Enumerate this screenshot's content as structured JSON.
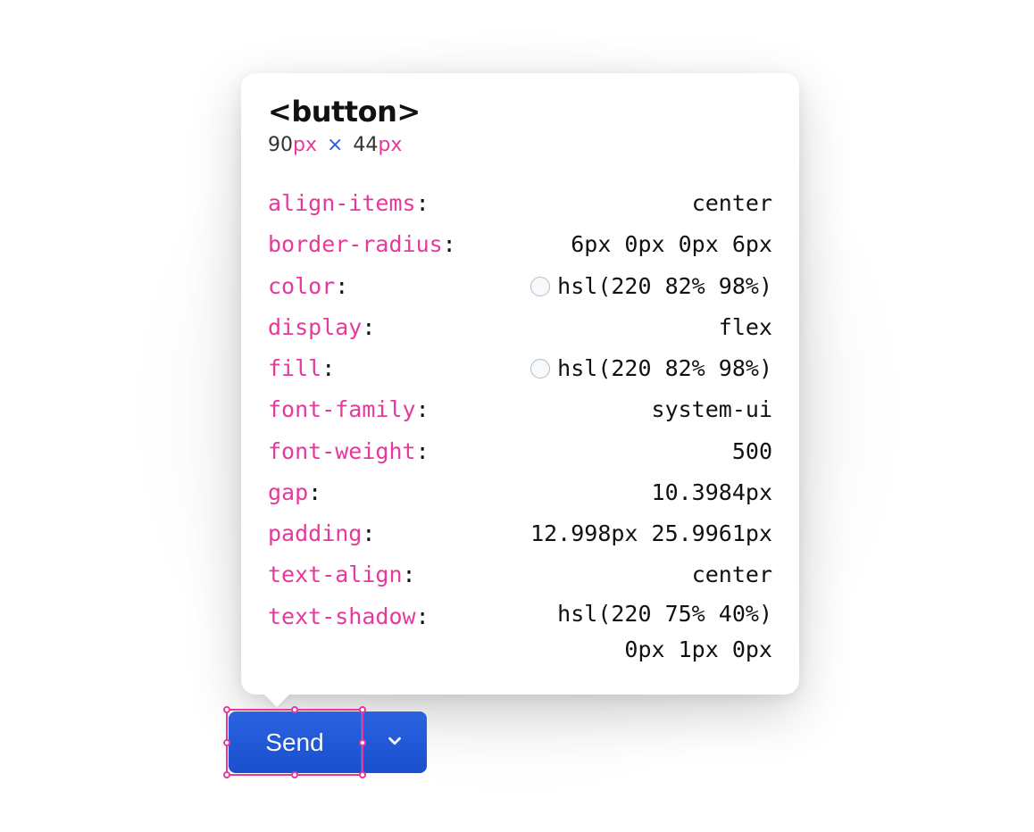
{
  "tooltip": {
    "element_tag": "<button>",
    "dimensions": {
      "w": "90",
      "wUnit": "px",
      "sep": "×",
      "h": "44",
      "hUnit": "px"
    },
    "properties": [
      {
        "name": "align-items",
        "value": "center"
      },
      {
        "name": "border-radius",
        "value": "6px 0px 0px 6px"
      },
      {
        "name": "color",
        "value": "hsl(220 82% 98%)",
        "swatch": "hsl(220 82% 98%)"
      },
      {
        "name": "display",
        "value": "flex"
      },
      {
        "name": "fill",
        "value": "hsl(220 82% 98%)",
        "swatch": "hsl(220 82% 98%)"
      },
      {
        "name": "font-family",
        "value": "system-ui"
      },
      {
        "name": "font-weight",
        "value": "500"
      },
      {
        "name": "gap",
        "value": "10.3984px"
      },
      {
        "name": "padding",
        "value": "12.998px 25.9961px"
      },
      {
        "name": "text-align",
        "value": "center"
      },
      {
        "name": "text-shadow",
        "value": "hsl(220 75% 40%) 0px 1px 0px",
        "multiline": [
          "hsl(220 75% 40%)",
          "0px 1px 0px"
        ]
      }
    ]
  },
  "button": {
    "send_label": "Send"
  }
}
